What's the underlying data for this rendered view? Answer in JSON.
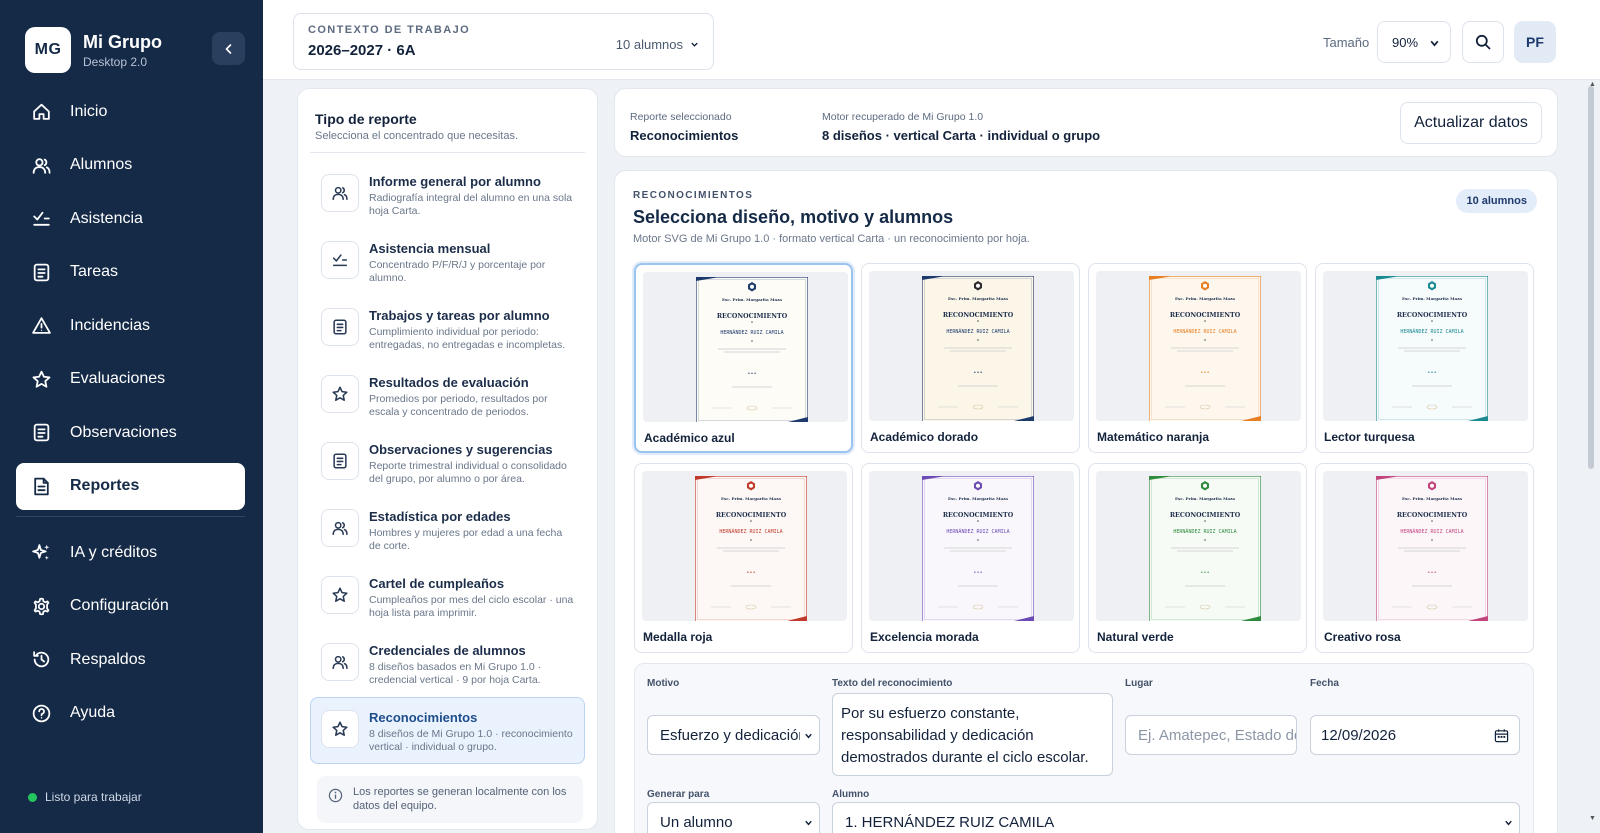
{
  "app": {
    "logo": "MG",
    "name": "Mi Grupo",
    "version": "Desktop 2.0"
  },
  "sidebar": {
    "items": [
      {
        "label": "Inicio",
        "icon": "home-icon"
      },
      {
        "label": "Alumnos",
        "icon": "users-icon"
      },
      {
        "label": "Asistencia",
        "icon": "checklist-icon"
      },
      {
        "label": "Tareas",
        "icon": "document-icon"
      },
      {
        "label": "Incidencias",
        "icon": "warning-icon"
      },
      {
        "label": "Evaluaciones",
        "icon": "star-icon"
      },
      {
        "label": "Observaciones",
        "icon": "document-icon"
      },
      {
        "label": "Reportes",
        "icon": "report-icon",
        "active": true
      }
    ],
    "items2": [
      {
        "label": "IA y créditos",
        "icon": "sparkles-icon"
      },
      {
        "label": "Configuración",
        "icon": "gear-icon"
      },
      {
        "label": "Respaldos",
        "icon": "history-icon"
      },
      {
        "label": "Ayuda",
        "icon": "help-icon"
      }
    ],
    "status": "Listo para trabajar"
  },
  "topbar": {
    "context_label": "CONTEXTO DE TRABAJO",
    "context_value": "2026–2027 · 6A",
    "context_count": "10 alumnos",
    "size_label": "Tamaño",
    "size_value": "90%",
    "avatar": "PF"
  },
  "reports": {
    "title": "Tipo de reporte",
    "subtitle": "Selecciona el concentrado que necesitas.",
    "items": [
      {
        "title": "Informe general por alumno",
        "desc": "Radiografía integral del alumno en una sola hoja Carta.",
        "icon": "users-icon"
      },
      {
        "title": "Asistencia mensual",
        "desc": "Concentrado P/F/R/J y porcentaje por alumno.",
        "icon": "checklist-icon"
      },
      {
        "title": "Trabajos y tareas por alumno",
        "desc": "Cumplimiento individual por periodo: entregadas, no entregadas e incompletas.",
        "icon": "document-icon"
      },
      {
        "title": "Resultados de evaluación",
        "desc": "Promedios por periodo, resultados por escala y concentrado de periodos.",
        "icon": "star-icon"
      },
      {
        "title": "Observaciones y sugerencias",
        "desc": "Reporte trimestral individual o consolidado del grupo, por alumno o por área.",
        "icon": "document-icon"
      },
      {
        "title": "Estadística por edades",
        "desc": "Hombres y mujeres por edad a una fecha de corte.",
        "icon": "users-icon"
      },
      {
        "title": "Cartel de cumpleaños",
        "desc": "Cumpleaños por mes del ciclo escolar · una hoja lista para imprimir.",
        "icon": "star-icon"
      },
      {
        "title": "Credenciales de alumnos",
        "desc": "8 diseños basados en Mi Grupo 1.0 · credencial vertical · 9 por hoja Carta.",
        "icon": "users-icon"
      },
      {
        "title": "Reconocimientos",
        "desc": "8 diseños de Mi Grupo 1.0 · reconocimiento vertical · individual o grupo.",
        "icon": "star-icon",
        "active": true
      }
    ],
    "info": "Los reportes se generan localmente con los datos del equipo."
  },
  "summary": {
    "selected_label": "Reporte seleccionado",
    "selected_value": "Reconocimientos",
    "engine_label": "Motor recuperado de Mi Grupo 1.0",
    "engine_value": "8 diseños · vertical Carta · individual o grupo",
    "update_button": "Actualizar datos"
  },
  "main": {
    "eyebrow": "RECONOCIMIENTOS",
    "title": "Selecciona diseño, motivo y alumnos",
    "subtitle": "Motor SVG de Mi Grupo 1.0 · formato vertical Carta · un reconocimiento por hoja.",
    "badge": "10 alumnos"
  },
  "certificate": {
    "school": "Esc. Prim. Margarita Maza",
    "heading": "RECONOCIMIENTO",
    "student": "HERNÁNDEZ RUIZ CAMILA"
  },
  "designs": [
    {
      "name": "Académico azul",
      "color": "#1e3a6d",
      "bg": "#fdfcf7",
      "selected": true
    },
    {
      "name": "Académico dorado",
      "color": "#1e3a6d",
      "bg": "#fbf6e8",
      "medal": "#2b2b2b"
    },
    {
      "name": "Matemático naranja",
      "color": "#e67e22",
      "bg": "#fdf7ee"
    },
    {
      "name": "Lector turquesa",
      "color": "#1b8a91",
      "bg": "#f6fbfb"
    },
    {
      "name": "Medalla roja",
      "color": "#c0392b",
      "bg": "#fdf8f6"
    },
    {
      "name": "Excelencia morada",
      "color": "#6c4bb6",
      "bg": "#f9f7fc"
    },
    {
      "name": "Natural verde",
      "color": "#2e8b3e",
      "bg": "#f7fbf6"
    },
    {
      "name": "Creativo rosa",
      "color": "#c2457e",
      "bg": "#fcf6f9"
    }
  ],
  "form": {
    "motivo_label": "Motivo",
    "motivo_value": "Esfuerzo y dedicación",
    "texto_label": "Texto del reconocimiento",
    "texto_value": "Por su esfuerzo constante, responsabilidad y dedicación demostrados durante el ciclo escolar.",
    "lugar_label": "Lugar",
    "lugar_placeholder": "Ej. Amatepec, Estado de México",
    "fecha_label": "Fecha",
    "fecha_value": "12/09/2026",
    "generar_label": "Generar para",
    "generar_value": "Un alumno",
    "alumno_label": "Alumno",
    "alumno_value": "1. HERNÁNDEZ RUIZ CAMILA"
  }
}
